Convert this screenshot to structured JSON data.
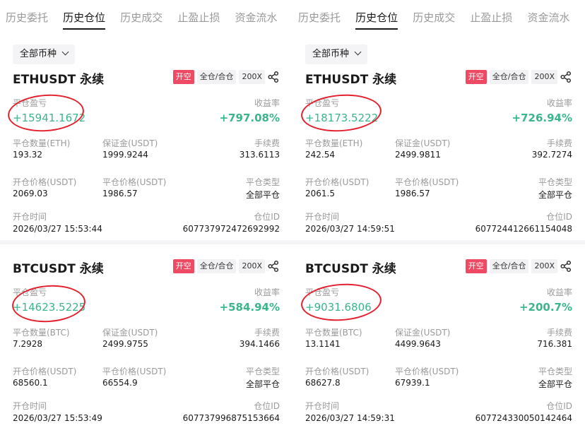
{
  "tabs": [
    "历史委托",
    "历史仓位",
    "历史成交",
    "止盈止损",
    "资金流水"
  ],
  "active_tab": 1,
  "filter_label": "全部币种",
  "labels": {
    "pnl": "平仓盈亏",
    "rate": "收益率",
    "qty_eth": "平仓数量(ETH)",
    "qty_btc": "平仓数量(BTC)",
    "margin": "保证金(USDT)",
    "fee": "手续费",
    "open_price": "开仓价格(USDT)",
    "close_price": "平仓价格(USDT)",
    "close_type": "平仓类型",
    "open_time": "开仓时间",
    "position_id": "仓位ID"
  },
  "tags": {
    "side": "开空",
    "mode": "全仓/合仓",
    "leverage": "200X"
  },
  "panels": [
    {
      "cards": [
        {
          "title": "ETHUSDT 永续",
          "pnl": "+15941.1672",
          "rate": "+797.08%",
          "qty": "193.32",
          "margin": "1999.9244",
          "fee": "313.6113",
          "open_price": "2069.03",
          "close_price": "1986.57",
          "close_type": "全部平仓",
          "open_time": "2026/03/27 15:53:44",
          "position_id": "607737972472692992"
        },
        {
          "title": "BTCUSDT 永续",
          "pnl": "+14623.5225",
          "rate": "+584.94%",
          "qty": "7.2928",
          "margin": "2499.9755",
          "fee": "394.1466",
          "open_price": "68560.1",
          "close_price": "66554.9",
          "close_type": "全部平仓",
          "open_time": "2026/03/27 15:53:49",
          "position_id": "607737996875153664"
        }
      ]
    },
    {
      "cards": [
        {
          "title": "ETHUSDT 永续",
          "pnl": "+18173.5222",
          "rate": "+726.94%",
          "qty": "242.54",
          "margin": "2499.9811",
          "fee": "392.7274",
          "open_price": "2061.5",
          "close_price": "1986.57",
          "close_type": "全部平仓",
          "open_time": "2026/03/27 14:59:51",
          "position_id": "607724412661154048"
        },
        {
          "title": "BTCUSDT 永续",
          "pnl": "+9031.6806",
          "rate": "+200.7%",
          "qty": "13.1141",
          "margin": "4499.9643",
          "fee": "716.381",
          "open_price": "68627.8",
          "close_price": "67939.1",
          "close_type": "全部平仓",
          "open_time": "2026/03/27 14:59:31",
          "position_id": "607724330050142464"
        }
      ]
    }
  ],
  "colors": {
    "profit": "#3bb58a",
    "tag_red": "#ee4a63",
    "annotation": "#e4202e"
  },
  "icons": {
    "filter": "chevron-down-icon",
    "share": "share-icon"
  }
}
